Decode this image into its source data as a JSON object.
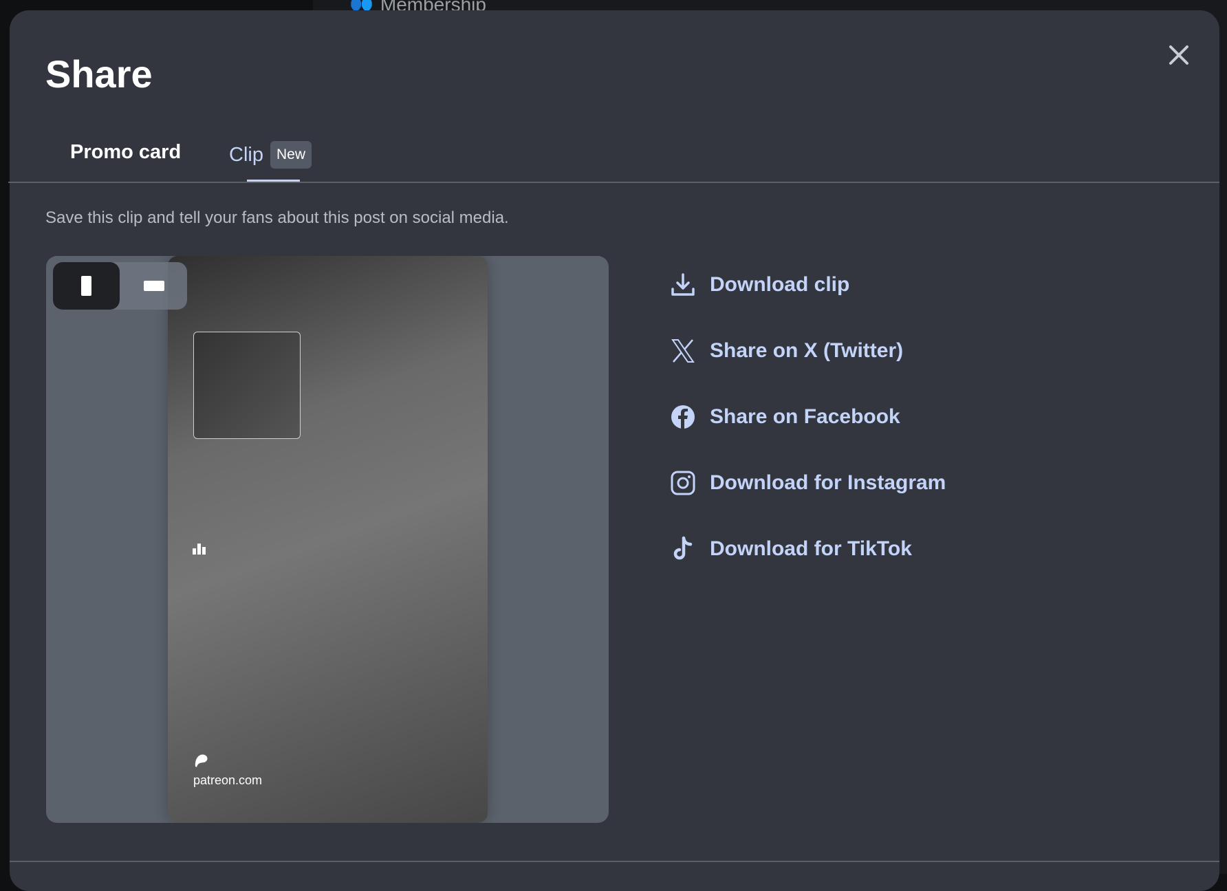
{
  "background": {
    "nav_item": "Membership"
  },
  "modal": {
    "title": "Share",
    "tabs": [
      {
        "label": "Promo card"
      },
      {
        "label": "Clip",
        "badge": "New",
        "active": true
      }
    ],
    "description": "Save this clip and tell your fans about this post on social media.",
    "preview": {
      "site": "patreon.com",
      "orientation": "portrait"
    },
    "actions": [
      {
        "label": "Download clip",
        "icon": "download-icon"
      },
      {
        "label": "Share on X (Twitter)",
        "icon": "x-icon"
      },
      {
        "label": "Share on Facebook",
        "icon": "facebook-icon"
      },
      {
        "label": "Download for Instagram",
        "icon": "instagram-icon"
      },
      {
        "label": "Download for TikTok",
        "icon": "tiktok-icon"
      }
    ],
    "accent": "#c3d4f8"
  }
}
